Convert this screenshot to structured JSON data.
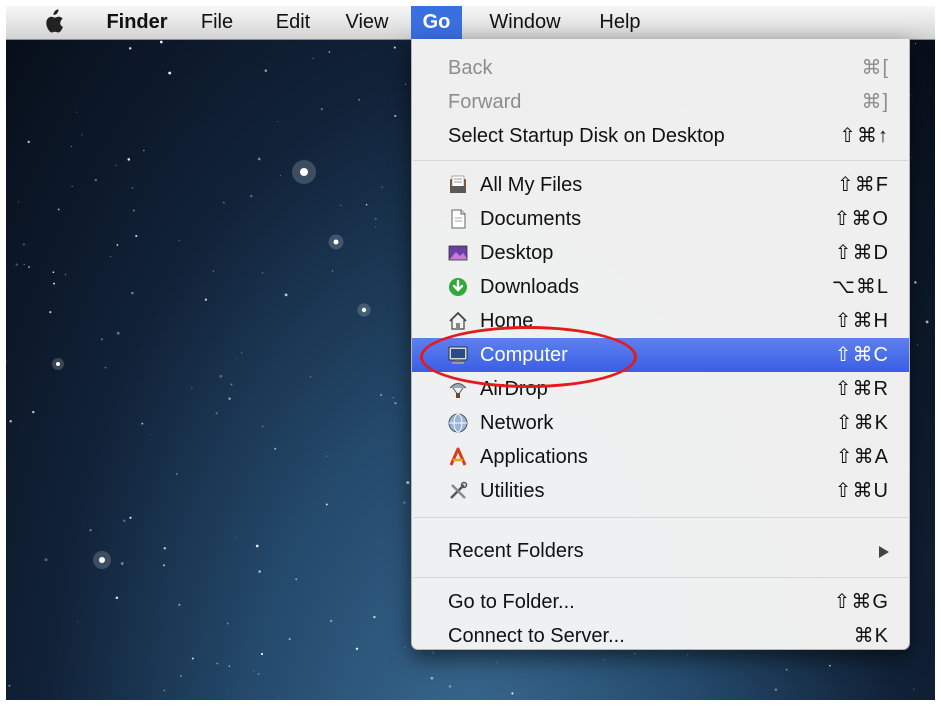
{
  "menubar": {
    "apple_icon": "apple-logo-icon",
    "items": [
      {
        "label": "Finder"
      },
      {
        "label": "File"
      },
      {
        "label": "Edit"
      },
      {
        "label": "View"
      },
      {
        "label": "Go",
        "active": true
      },
      {
        "label": "Window"
      },
      {
        "label": "Help"
      }
    ]
  },
  "go_menu": {
    "items": [
      {
        "label": "Back",
        "shortcut": "⌘[",
        "disabled": true
      },
      {
        "label": "Forward",
        "shortcut": "⌘]",
        "disabled": true
      },
      {
        "label": "Select Startup Disk on Desktop",
        "shortcut": "⇧⌘↑"
      },
      {
        "label": "All My Files",
        "shortcut": "⇧⌘F",
        "icon": "all-my-files-icon"
      },
      {
        "label": "Documents",
        "shortcut": "⇧⌘O",
        "icon": "documents-icon"
      },
      {
        "label": "Desktop",
        "shortcut": "⇧⌘D",
        "icon": "desktop-icon"
      },
      {
        "label": "Downloads",
        "shortcut": "⌥⌘L",
        "icon": "downloads-icon"
      },
      {
        "label": "Home",
        "shortcut": "⇧⌘H",
        "icon": "home-icon"
      },
      {
        "label": "Computer",
        "shortcut": "⇧⌘C",
        "icon": "computer-icon",
        "highlighted": true
      },
      {
        "label": "AirDrop",
        "shortcut": "⇧⌘R",
        "icon": "airdrop-icon"
      },
      {
        "label": "Network",
        "shortcut": "⇧⌘K",
        "icon": "network-icon"
      },
      {
        "label": "Applications",
        "shortcut": "⇧⌘A",
        "icon": "applications-icon"
      },
      {
        "label": "Utilities",
        "shortcut": "⇧⌘U",
        "icon": "utilities-icon"
      },
      {
        "label": "Recent Folders",
        "submenu": true
      },
      {
        "label": "Go to Folder...",
        "shortcut": "⇧⌘G"
      },
      {
        "label": "Connect to Server...",
        "shortcut": "⌘K"
      }
    ]
  },
  "colors": {
    "highlight": "#3b5fe4",
    "annotation": "#e31b1b",
    "menu_active": "#3a6fe0"
  }
}
